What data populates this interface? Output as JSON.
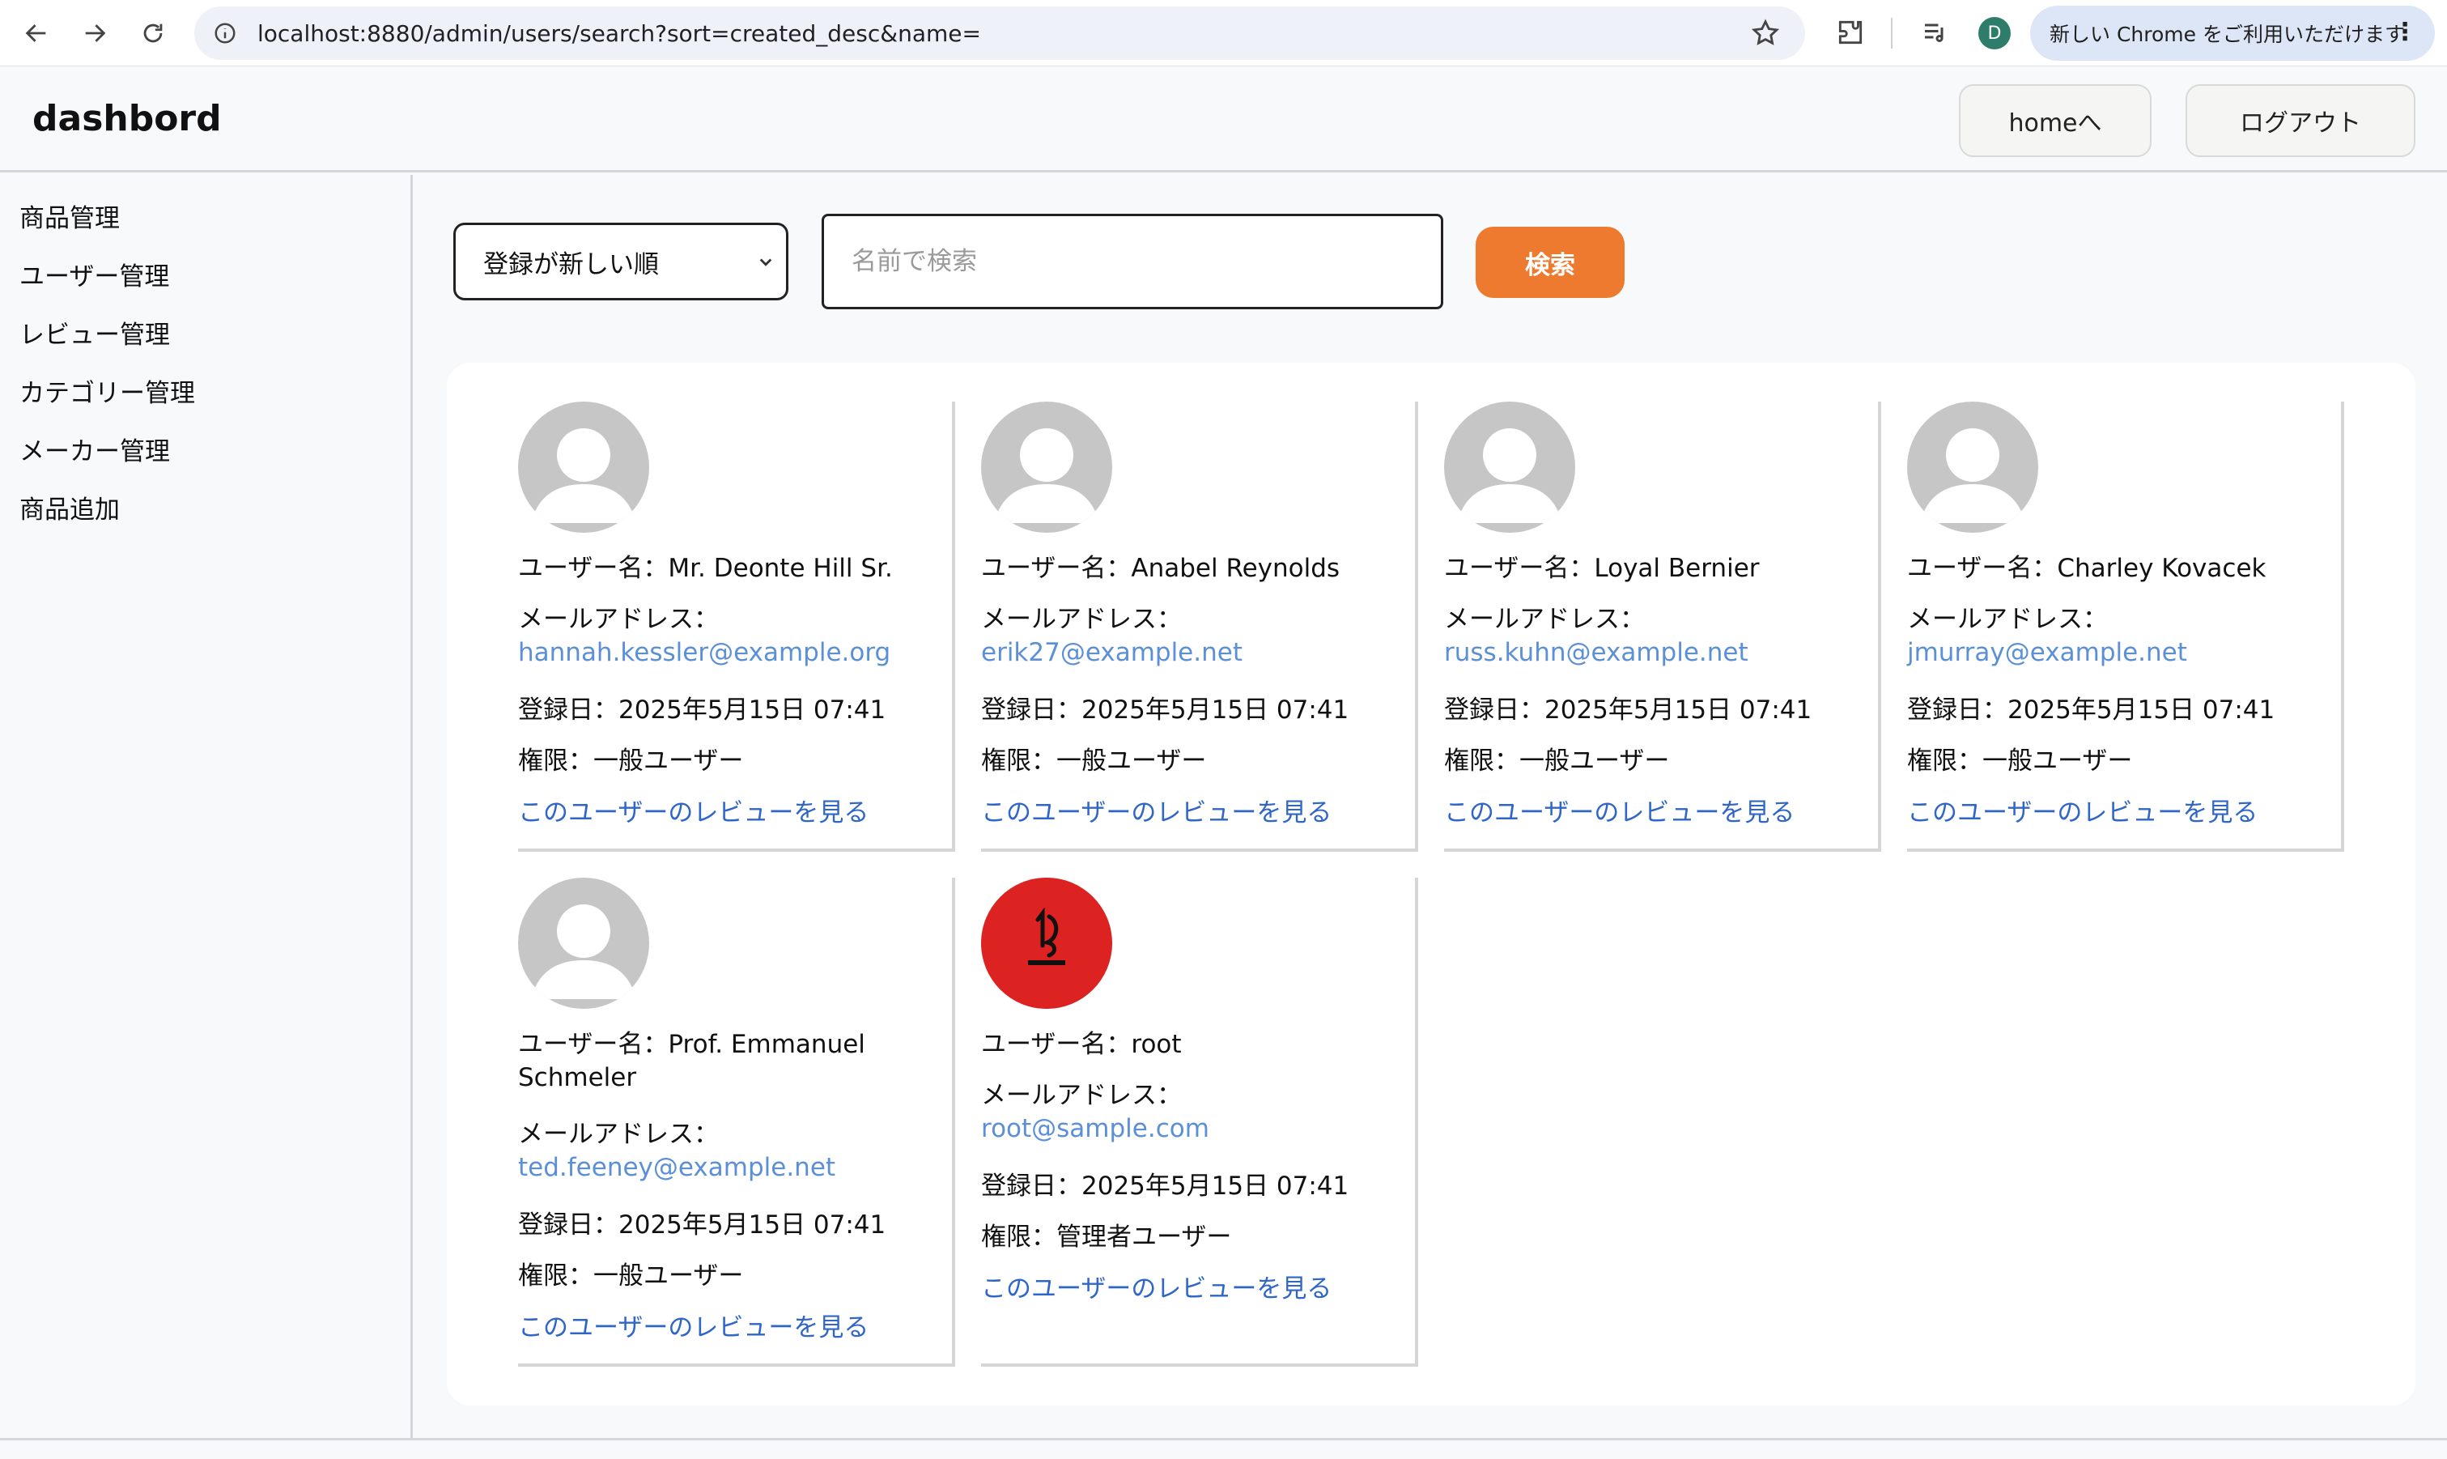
{
  "browser": {
    "url": "localhost:8880/admin/users/search?sort=created_desc&name=",
    "profile_initial": "D",
    "update_text": "新しい Chrome をご利用いただけます",
    "kebab": "⋮"
  },
  "header": {
    "brand": "dashbord",
    "home_button": "homeへ",
    "logout_button": "ログアウト"
  },
  "sidebar": {
    "items": [
      {
        "label": "商品管理"
      },
      {
        "label": "ユーザー管理"
      },
      {
        "label": "レビュー管理"
      },
      {
        "label": "カテゴリー管理"
      },
      {
        "label": "メーカー管理"
      },
      {
        "label": "商品追加"
      }
    ]
  },
  "search": {
    "sort_selected": "登録が新しい順",
    "placeholder": "名前で検索",
    "value": "",
    "button": "検索"
  },
  "labels": {
    "username": "ユーザー名：",
    "email": "メールアドレス：",
    "registered": "登録日：",
    "role": "権限：",
    "review_link": "このユーザーのレビューを見る"
  },
  "users": [
    {
      "name": "Mr. Deonte Hill Sr.",
      "name_line2": "",
      "email": "hannah.kessler@example.org",
      "registered": "2025年5月15日 07:41",
      "role": "一般ユーザー",
      "avatar": "default"
    },
    {
      "name": "Anabel Reynolds",
      "name_line2": "",
      "email": "erik27@example.net",
      "registered": "2025年5月15日 07:41",
      "role": "一般ユーザー",
      "avatar": "default"
    },
    {
      "name": "Loyal Bernier",
      "name_line2": "",
      "email": "russ.kuhn@example.net",
      "registered": "2025年5月15日 07:41",
      "role": "一般ユーザー",
      "avatar": "default"
    },
    {
      "name": "Charley Kovacek",
      "name_line2": "",
      "email": "jmurray@example.net",
      "registered": "2025年5月15日 07:41",
      "role": "一般ユーザー",
      "avatar": "default"
    },
    {
      "name": "Prof. Emmanuel",
      "name_line2": "Schmeler",
      "email": "ted.feeney@example.net",
      "registered": "2025年5月15日 07:41",
      "role": "一般ユーザー",
      "avatar": "default"
    },
    {
      "name": "root",
      "name_line2": "",
      "email": "root@sample.com",
      "registered": "2025年5月15日 07:41",
      "role": "管理者ユーザー",
      "avatar": "custom-red"
    }
  ],
  "colors": {
    "accent": "#ee7a2f",
    "link": "#2f66c8",
    "email": "#5b8fd6",
    "avatar_default": "#c6c6c6",
    "avatar_custom": "#dd2222"
  }
}
